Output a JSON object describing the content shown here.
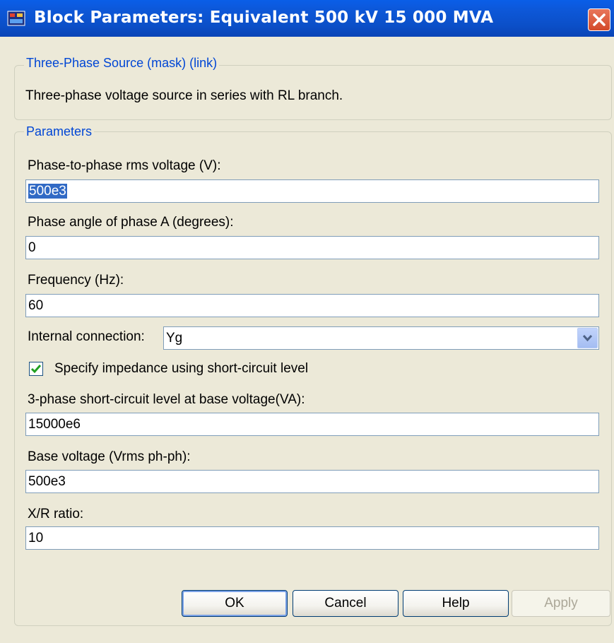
{
  "window": {
    "title": "Block Parameters: Equivalent 500 kV 15 000 MVA"
  },
  "description_group": {
    "legend": "Three-Phase Source (mask) (link)",
    "text": "Three-phase voltage source in series with RL branch."
  },
  "parameters_group": {
    "legend": "Parameters",
    "voltage": {
      "label": "Phase-to-phase rms voltage (V):",
      "value": "500e3"
    },
    "phase_angle": {
      "label": "Phase angle of phase A (degrees):",
      "value": "0"
    },
    "frequency": {
      "label": "Frequency (Hz):",
      "value": "60"
    },
    "connection": {
      "label": "Internal connection:",
      "value": "Yg"
    },
    "impedance_checkbox": {
      "label": "Specify impedance using short-circuit level",
      "checked": true
    },
    "short_circuit": {
      "label": "3-phase short-circuit level at base voltage(VA):",
      "value": "15000e6"
    },
    "base_voltage": {
      "label": "Base voltage (Vrms ph-ph):",
      "value": "500e3"
    },
    "xr_ratio": {
      "label": "X/R ratio:",
      "value": "10"
    }
  },
  "buttons": {
    "ok": "OK",
    "cancel": "Cancel",
    "help": "Help",
    "apply": "Apply"
  },
  "icons": {
    "title": "block-parameters-icon",
    "close": "close-icon",
    "dropdown": "chevron-down-icon",
    "check": "checkmark-icon"
  },
  "colors": {
    "titlebar": "#0b4fc8",
    "legend_text": "#0046d5",
    "selection": "#316ac5",
    "close_button": "#d34a2a"
  }
}
